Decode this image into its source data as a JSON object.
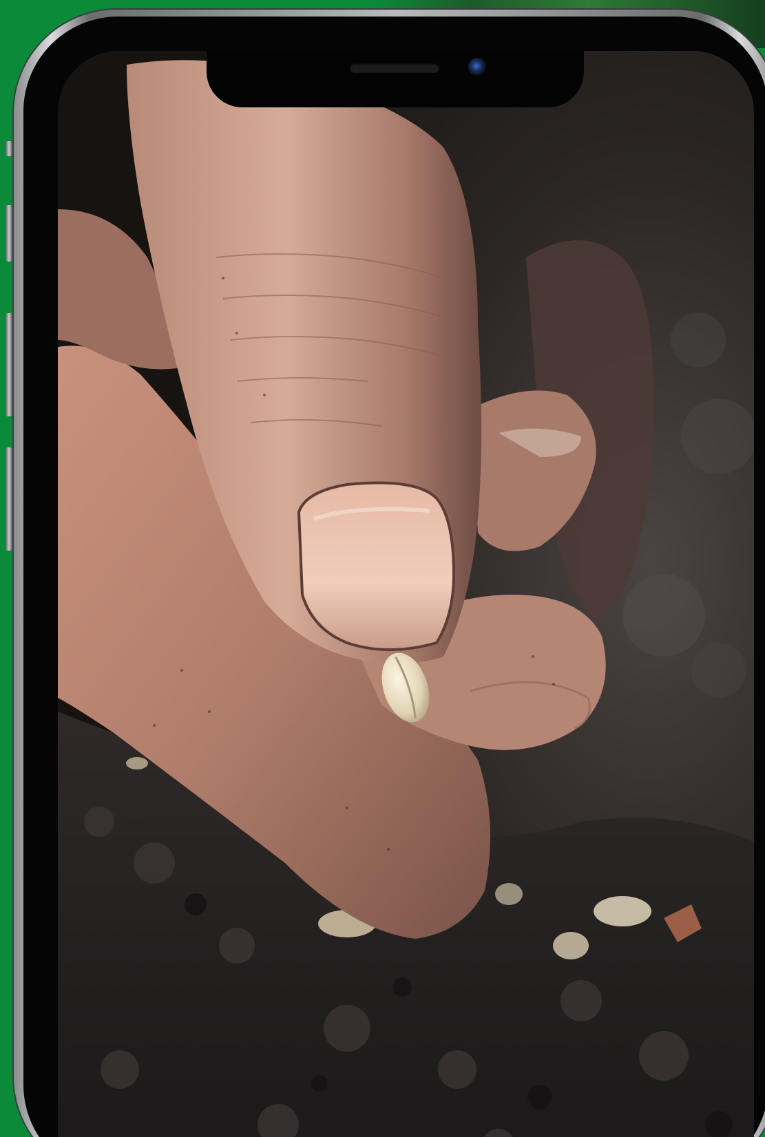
{
  "device": {
    "type": "smartphone",
    "frame_color": "#b8babc",
    "background_color": "#0b8a3a"
  },
  "screen": {
    "content": "photo",
    "accent_colors": {
      "skin": "#b98a76",
      "soil": "#2a2624",
      "seed": "#e8dcc4"
    }
  },
  "icons": {
    "camera": "front-camera-icon",
    "speaker": "earpiece-speaker-icon"
  }
}
